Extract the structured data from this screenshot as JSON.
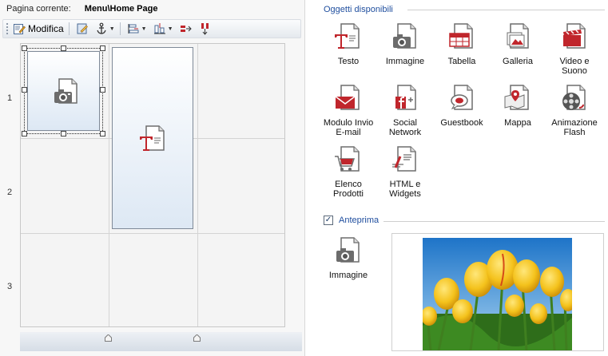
{
  "header": {
    "current_page_label": "Pagina corrente:",
    "current_page_value": "Menu\\Home Page"
  },
  "toolbar": {
    "edit_label": "Modifica",
    "buttons": [
      "edit-properties-icon",
      "anchor-icon",
      "align-icon",
      "distribute-icon",
      "merge-icon",
      "split-icon"
    ]
  },
  "grid": {
    "row_labels": [
      "1",
      "2",
      "3"
    ],
    "objects": [
      {
        "type": "Immagine",
        "icon": "camera-icon",
        "selected": true
      },
      {
        "type": "Testo",
        "icon": "text-icon",
        "selected": false
      }
    ]
  },
  "objects_panel": {
    "title": "Oggetti disponibili",
    "items": [
      {
        "label": "Testo",
        "icon": "text-icon"
      },
      {
        "label": "Immagine",
        "icon": "camera-icon"
      },
      {
        "label": "Tabella",
        "icon": "table-icon"
      },
      {
        "label": "Galleria",
        "icon": "gallery-icon"
      },
      {
        "label": "Video e Suono",
        "icon": "video-icon"
      },
      {
        "label": "Modulo Invio E-mail",
        "icon": "email-icon"
      },
      {
        "label": "Social Network",
        "icon": "social-icon"
      },
      {
        "label": "Guestbook",
        "icon": "guestbook-icon"
      },
      {
        "label": "Mappa",
        "icon": "map-icon"
      },
      {
        "label": "Animazione Flash",
        "icon": "flash-icon"
      },
      {
        "label": "Elenco Prodotti",
        "icon": "cart-icon"
      },
      {
        "label": "HTML e Widgets",
        "icon": "html-icon"
      }
    ]
  },
  "preview": {
    "checkbox_label": "Anteprima",
    "checked": true,
    "item_label": "Immagine"
  },
  "colors": {
    "accent": "#1f4e9e",
    "icon_red": "#c0262c"
  }
}
